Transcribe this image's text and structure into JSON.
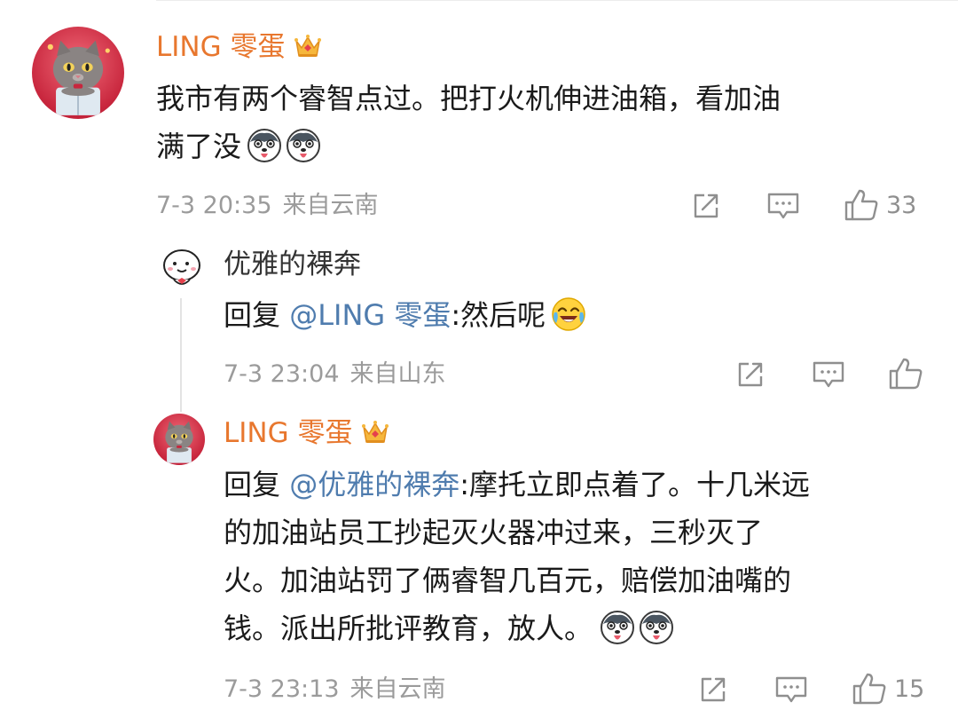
{
  "comment": {
    "username": "LING 零蛋",
    "content_lines": [
      "我市有两个睿智点过。把打火机伸进油箱，看加油",
      "满了没"
    ],
    "time": "7-3 20:35",
    "location": "来自云南",
    "like_count": "33"
  },
  "reply_1": {
    "username": "优雅的裸奔",
    "reply_prefix": "回复 ",
    "mention": "@LING 零蛋",
    "text": ":然后呢",
    "time": "7-3 23:04",
    "location": "来自山东",
    "like_count": ""
  },
  "reply_2": {
    "username": "LING 零蛋",
    "reply_prefix": "回复 ",
    "mention": "@优雅的裸奔",
    "line1_rest": ":摩托立即点着了。十几米远",
    "lines": [
      "的加油站员工抄起灭火器冲过来，三秒灭了",
      "火。加油站罚了俩睿智几百元，赔偿加油嘴的",
      "钱。派出所批评教育，放人。"
    ],
    "time": "7-3 23:13",
    "location": "来自云南",
    "like_count": "15"
  },
  "colors": {
    "vip_name": "#e8772e",
    "mention": "#4f7cae",
    "meta": "#9b9b9b"
  },
  "icons": [
    "crown-icon",
    "husky-emoji",
    "laugh-cry-emoji",
    "repost-icon",
    "comment-icon",
    "like-icon"
  ]
}
